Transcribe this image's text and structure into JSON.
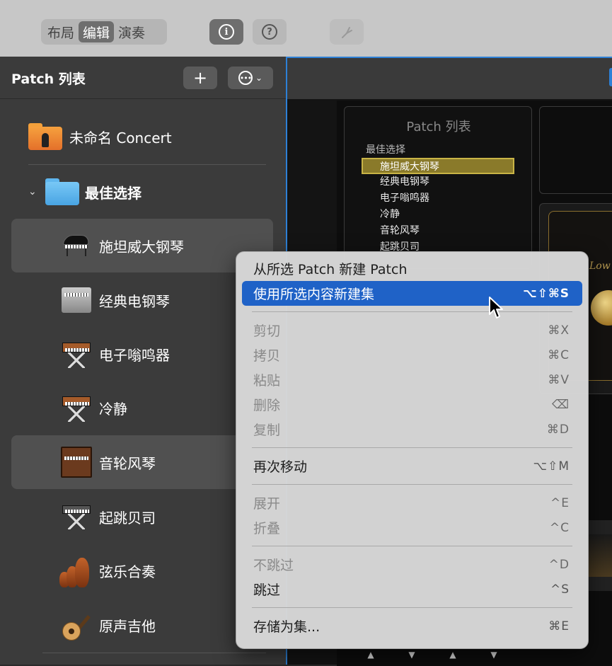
{
  "toolbar": {
    "segments": [
      "布局",
      "编辑",
      "演奏"
    ],
    "active_segment": "编辑",
    "info_icon": "info-icon",
    "help_icon": "help-icon",
    "tuner_icon": "tuning-fork-icon"
  },
  "sidebar": {
    "title": "Patch 列表",
    "add_label": "+",
    "concert": "未命名 Concert",
    "folder": "最佳选择",
    "patches": [
      {
        "label": "施坦威大钢琴",
        "icon": "grand-piano-icon",
        "selected": true
      },
      {
        "label": "经典电钢琴",
        "icon": "electric-piano-icon",
        "selected": false
      },
      {
        "label": "电子嗡鸣器",
        "icon": "synth-icon",
        "selected": false
      },
      {
        "label": "冷静",
        "icon": "synth-icon",
        "selected": false
      },
      {
        "label": "音轮风琴",
        "icon": "organ-icon",
        "selected": true
      },
      {
        "label": "起跳贝司",
        "icon": "bass-synth-icon",
        "selected": false
      },
      {
        "label": "弦乐合奏",
        "icon": "strings-icon",
        "selected": false
      },
      {
        "label": "原声吉他",
        "icon": "acoustic-guitar-icon",
        "selected": false
      }
    ]
  },
  "stage": {
    "patch_list_title": "Patch 列表",
    "category": "最佳选择",
    "items": [
      "施坦威大钢琴",
      "经典电钢琴",
      "电子嗡鸣器",
      "冷静",
      "音轮风琴",
      "起跳贝司"
    ],
    "selected_item": "施坦威大钢琴",
    "low_label": "Low"
  },
  "context_menu": {
    "items": [
      {
        "label": "从所选 Patch 新建 Patch",
        "shortcut": "",
        "state": "enabled"
      },
      {
        "label": "使用所选内容新建集",
        "shortcut": "⌥⇧⌘S",
        "state": "highlighted"
      },
      {
        "sep": true
      },
      {
        "label": "剪切",
        "shortcut": "⌘X",
        "state": "disabled"
      },
      {
        "label": "拷贝",
        "shortcut": "⌘C",
        "state": "disabled"
      },
      {
        "label": "粘贴",
        "shortcut": "⌘V",
        "state": "disabled"
      },
      {
        "label": "删除",
        "shortcut": "⌫",
        "state": "disabled"
      },
      {
        "label": "复制",
        "shortcut": "⌘D",
        "state": "disabled"
      },
      {
        "sep": true
      },
      {
        "label": "再次移动",
        "shortcut": "⌥⇧M",
        "state": "enabled"
      },
      {
        "sep": true
      },
      {
        "label": "展开",
        "shortcut": "^E",
        "state": "disabled"
      },
      {
        "label": "折叠",
        "shortcut": "^C",
        "state": "disabled"
      },
      {
        "sep": true
      },
      {
        "label": "不跳过",
        "shortcut": "^D",
        "state": "disabled"
      },
      {
        "label": "跳过",
        "shortcut": "^S",
        "state": "enabled"
      },
      {
        "sep": true
      },
      {
        "label": "存储为集...",
        "shortcut": "⌘E",
        "state": "enabled"
      }
    ]
  },
  "colors": {
    "highlight": "#1f62c7",
    "selection_gold": "#c9b446",
    "focus_border": "#2d80d6"
  }
}
